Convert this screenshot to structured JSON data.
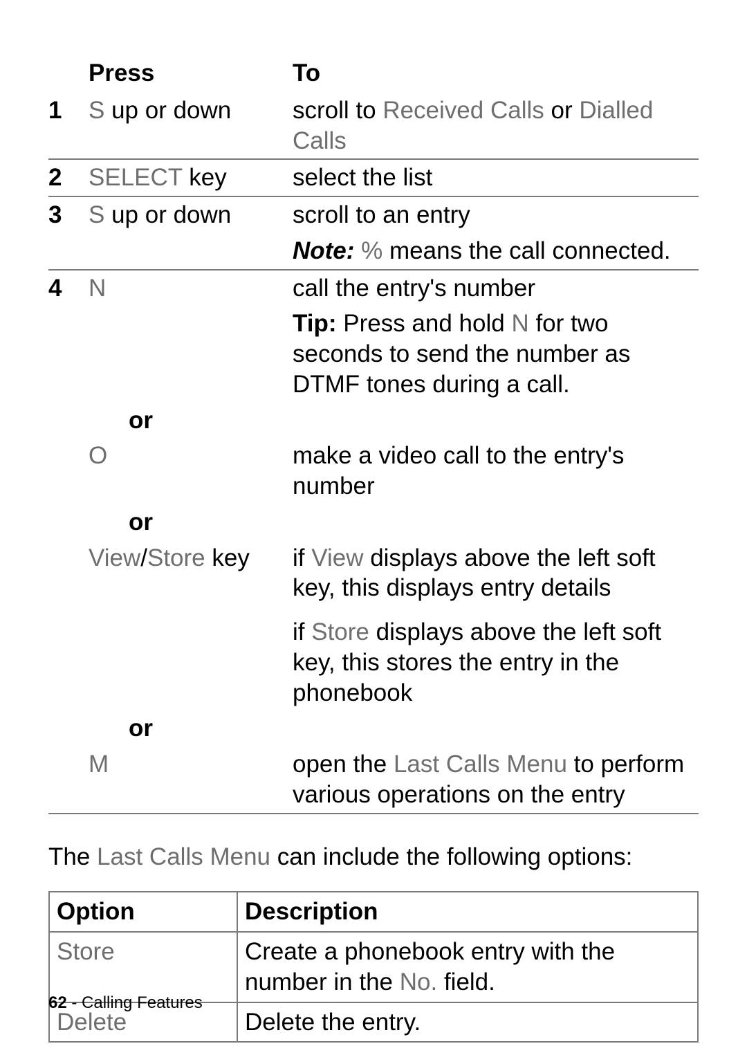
{
  "steps_table": {
    "headers": {
      "press": "Press",
      "to": "To"
    },
    "rows": [
      {
        "num": "1",
        "press_pre": "S ",
        "press_suffix": "up or down",
        "to_pre": "scroll to ",
        "to_mid1": "Received Calls",
        "to_join": " or ",
        "to_mid2": "Dialled Calls"
      },
      {
        "num": "2",
        "press_pre": "SELECT ",
        "press_suffix": "key",
        "to": "select the list"
      },
      {
        "num": "3",
        "press_pre": "S ",
        "press_suffix": "up or down",
        "to": "scroll to an entry",
        "note_label": "Note:",
        "note_mid": " % ",
        "note_rest": "means the call connected."
      },
      {
        "num": "4",
        "press": "N",
        "to": "call the entry's number",
        "tip_label": "Tip:",
        "tip_pre": " Press and hold ",
        "tip_key": "N",
        "tip_rest": " for two seconds to send the number as DTMF tones during a call."
      }
    ],
    "or": "or",
    "alt_q": {
      "press": "O",
      "to": "make a video call to the entry's number"
    },
    "alt_view": {
      "press_v": "View",
      "press_sep": "/",
      "press_s": "Store",
      "press_suffix": " key",
      "to1_pre": "if ",
      "to1_v": "View",
      "to1_rest": " displays above the left soft key, this displays entry details",
      "to2_pre": "if ",
      "to2_s": "Store",
      "to2_rest": " displays above the left soft key, this stores the entry in the phonebook"
    },
    "alt_m": {
      "press": "M",
      "to_pre": "open the ",
      "to_menu": "Last Calls Menu",
      "to_rest": " to perform various operations on the entry"
    }
  },
  "paragraph": {
    "pre": "The ",
    "menu": "Last Calls Menu",
    "rest": " can include the following options:"
  },
  "options_table": {
    "headers": {
      "option": "Option",
      "description": "Description"
    },
    "rows": [
      {
        "option": "Store",
        "desc_pre": "Create a phonebook entry with the number in the ",
        "desc_field": "No.",
        "desc_rest": " field."
      },
      {
        "option": "Delete",
        "desc": "Delete the entry."
      }
    ]
  },
  "footer": {
    "page": "62",
    "sep": " - ",
    "section": "Calling Features"
  }
}
